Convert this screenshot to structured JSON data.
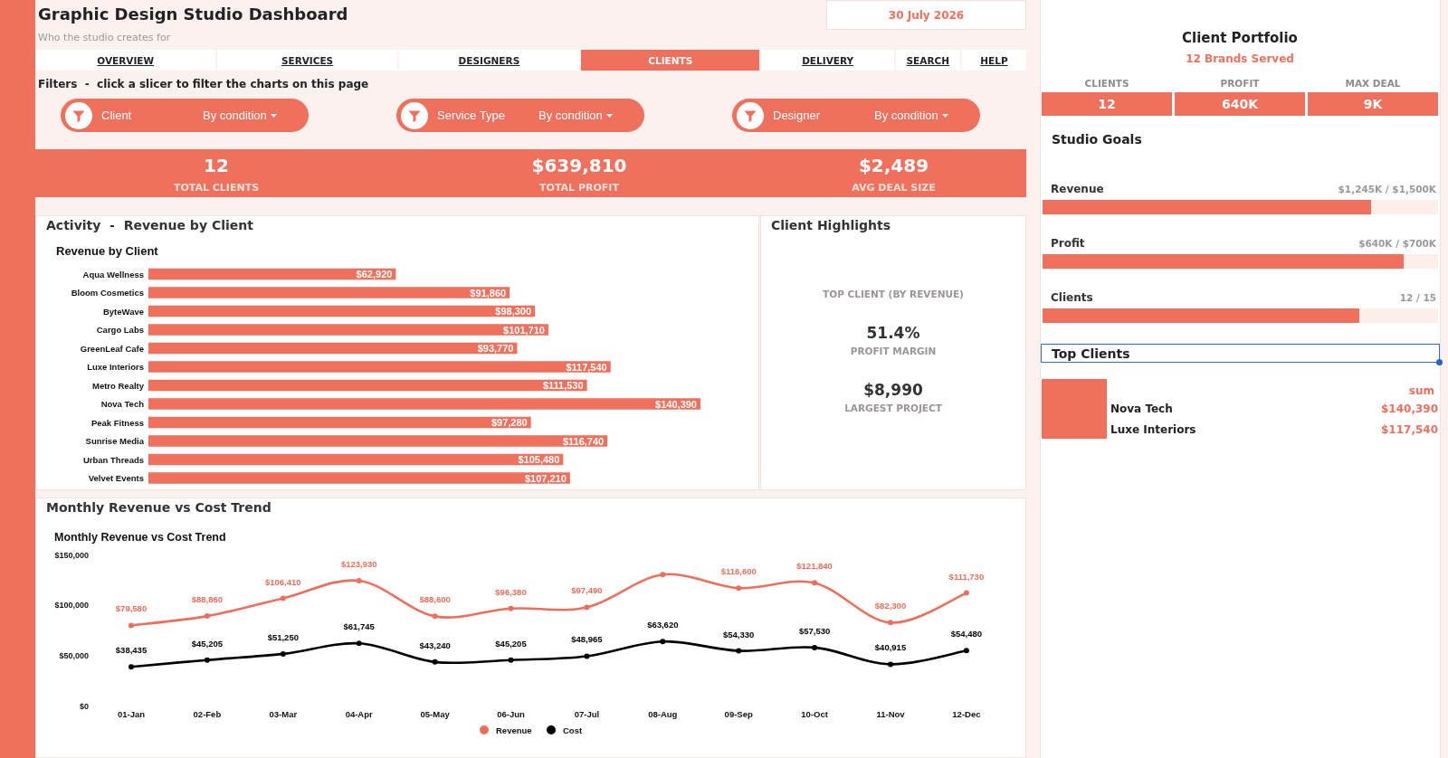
{
  "header": {
    "title": "Graphic Design Studio Dashboard",
    "subtitle": "Who the studio creates for",
    "date": "30 July 2026"
  },
  "tabs": [
    {
      "label": "OVERVIEW",
      "selected": false
    },
    {
      "label": "SERVICES",
      "selected": false
    },
    {
      "label": "DESIGNERS",
      "selected": false
    },
    {
      "label": "CLIENTS",
      "selected": true
    },
    {
      "label": "DELIVERY",
      "selected": false
    },
    {
      "label": "SEARCH",
      "selected": false
    },
    {
      "label": "HELP",
      "selected": false
    }
  ],
  "filters": {
    "hint": "Filters  -  click a slicer to filter the charts on this page",
    "slicers": [
      {
        "label": "Client",
        "condition": "By condition"
      },
      {
        "label": "Service Type",
        "condition": "By condition"
      },
      {
        "label": "Designer",
        "condition": "By condition"
      }
    ]
  },
  "kpis": [
    {
      "value": "12",
      "label": "TOTAL CLIENTS"
    },
    {
      "value": "$639,810",
      "label": "TOTAL PROFIT"
    },
    {
      "value": "$2,489",
      "label": "AVG DEAL SIZE"
    }
  ],
  "activity": {
    "title": "Activity  -  Revenue by Client",
    "chart_data": {
      "type": "bar",
      "orientation": "horizontal",
      "title": "Revenue by Client",
      "categories": [
        "Aqua Wellness",
        "Bloom Cosmetics",
        "ByteWave",
        "Cargo Labs",
        "GreenLeaf Cafe",
        "Luxe Interiors",
        "Metro Realty",
        "Nova Tech",
        "Peak Fitness",
        "Sunrise Media",
        "Urban Threads",
        "Velvet Events"
      ],
      "values": [
        62920,
        91860,
        98300,
        101710,
        93770,
        117540,
        111530,
        140390,
        97280,
        116740,
        105480,
        107210
      ],
      "value_labels": [
        "$62,920",
        "$91,860",
        "$98,300",
        "$101,710",
        "$93,770",
        "$117,540",
        "$111,530",
        "$140,390",
        "$97,280",
        "$116,740",
        "$105,480",
        "$107,210"
      ]
    }
  },
  "highlights": {
    "title": "Client Highlights",
    "caption": "TOP CLIENT (BY REVENUE)",
    "metrics": [
      {
        "value": "51.4%",
        "label": "PROFIT MARGIN"
      },
      {
        "value": "$8,990",
        "label": "LARGEST PROJECT"
      }
    ]
  },
  "trend": {
    "title": "Monthly Revenue vs Cost Trend",
    "chart_data": {
      "type": "line",
      "title": "Monthly Revenue vs Cost Trend",
      "categories": [
        "01-Jan",
        "02-Feb",
        "03-Mar",
        "04-Apr",
        "05-May",
        "06-Jun",
        "07-Jul",
        "08-Aug",
        "09-Sep",
        "10-Oct",
        "11-Nov",
        "12-Dec"
      ],
      "series": [
        {
          "name": "Revenue",
          "color": "#ee6e5b",
          "marker": "circle",
          "values": [
            79580,
            88860,
            106410,
            123930,
            88600,
            96380,
            97490,
            130000,
            116600,
            121840,
            82300,
            111730
          ],
          "value_labels": [
            "$79,580",
            "$88,860",
            "$106,410",
            "$123,930",
            "$88,600",
            "$96,380",
            "$97,490",
            null,
            "$116,600",
            "$121,840",
            "$82,300",
            "$111,730"
          ]
        },
        {
          "name": "Cost",
          "color": "#000000",
          "marker": "circle",
          "values": [
            38435,
            45205,
            51250,
            61745,
            43240,
            45205,
            48965,
            63620,
            54330,
            57530,
            40915,
            54480
          ],
          "value_labels": [
            "$38,435",
            "$45,205",
            "$51,250",
            "$61,745",
            "$43,240",
            "$45,205",
            "$48,965",
            "$63,620",
            "$54,330",
            "$57,530",
            "$40,915",
            "$54,480"
          ]
        }
      ],
      "ylim": [
        0,
        150000
      ],
      "yticks": [
        {
          "value": 0,
          "label": "$0"
        },
        {
          "value": 50000,
          "label": "$50,000"
        },
        {
          "value": 100000,
          "label": "$100,000"
        },
        {
          "value": 150000,
          "label": "$150,000"
        }
      ],
      "legend": true
    }
  },
  "portfolio": {
    "title": "Client Portfolio",
    "subtitle": "12 Brands Served",
    "stats": [
      {
        "label": "CLIENTS",
        "value": "12"
      },
      {
        "label": "PROFIT",
        "value": "640K"
      },
      {
        "label": "MAX DEAL",
        "value": "9K"
      }
    ]
  },
  "goals": {
    "title": "Studio Goals",
    "items": [
      {
        "name": "Revenue",
        "reading": "$1,245K / $1,500K",
        "level": 0.83
      },
      {
        "name": "Profit",
        "reading": "$640K / $700K",
        "level": 0.914
      },
      {
        "name": "Clients",
        "reading": "12 / 15",
        "level": 0.8
      }
    ]
  },
  "top_clients": {
    "title": "Top Clients",
    "selected": true,
    "column": "sum",
    "rows": [
      {
        "name": "Nova Tech",
        "value": "$140,390"
      },
      {
        "name": "Luxe Interiors",
        "value": "$117,540"
      }
    ]
  }
}
